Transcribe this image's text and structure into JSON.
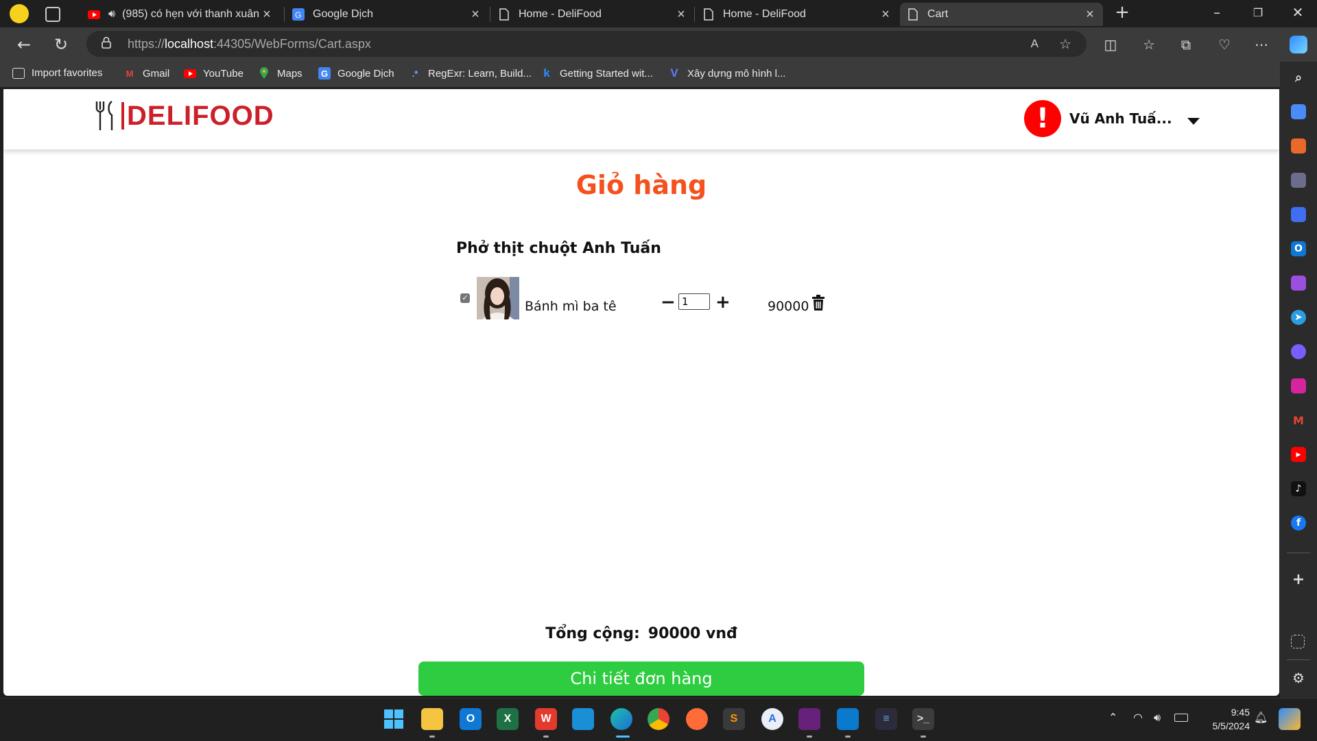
{
  "browser": {
    "tabs": [
      {
        "title": "(985) có hẹn với thanh xuân",
        "icon": "youtube-icon"
      },
      {
        "title": "Google Dịch",
        "icon": "google-translate-icon"
      },
      {
        "title": "Home - DeliFood",
        "icon": "page-icon"
      },
      {
        "title": "Home - DeliFood",
        "icon": "page-icon"
      },
      {
        "title": "Cart",
        "icon": "page-icon"
      }
    ],
    "url_scheme": "https://",
    "url_host": "localhost",
    "url_rest": ":44305/WebForms/Cart.aspx",
    "favorites": [
      {
        "label": "Import favorites",
        "icon": "import-icon"
      },
      {
        "label": "Gmail",
        "icon": "gmail-icon"
      },
      {
        "label": "YouTube",
        "icon": "youtube-icon"
      },
      {
        "label": "Maps",
        "icon": "maps-icon"
      },
      {
        "label": "Google Dịch",
        "icon": "google-translate-icon"
      },
      {
        "label": "RegExr: Learn, Build...",
        "icon": "regexr-icon"
      },
      {
        "label": "Getting Started wit...",
        "icon": "k-icon"
      },
      {
        "label": "Xây dựng mô hình l...",
        "icon": "v-icon"
      }
    ]
  },
  "site": {
    "logo_text": "DELIFOOD",
    "user_name": "Vũ Anh Tuấ...",
    "user_alert": "!"
  },
  "cart": {
    "title": "Giỏ hàng",
    "shop_name": "Phở thịt chuột Anh Tuấn",
    "items": [
      {
        "name": "Bánh mì ba tê",
        "quantity": "1",
        "price": "90000",
        "checked": true
      }
    ],
    "total_label": "Tổng cộng:",
    "total_value": "90000 vnđ",
    "detail_button": "Chi tiết đơn hàng"
  },
  "taskbar": {
    "time": "9:45",
    "date": "5/5/2024"
  },
  "colors": {
    "brand_red": "#cc1f2a",
    "title_orange": "#f4511e",
    "button_green": "#2ecc40"
  }
}
